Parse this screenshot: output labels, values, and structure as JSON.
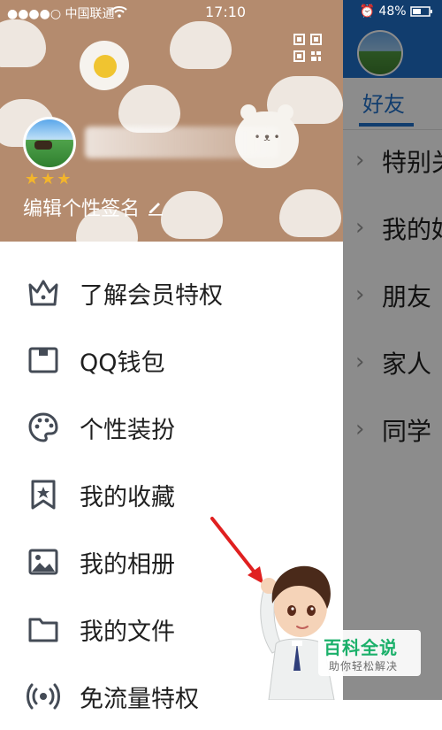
{
  "status_bar": {
    "carrier": "●●●●○ 中国联通",
    "time": "17:10",
    "battery": "48%"
  },
  "header": {
    "stars": "★★★",
    "signature": "编辑个性签名"
  },
  "menu": [
    {
      "label": "了解会员特权",
      "icon": "crown-icon"
    },
    {
      "label": "QQ钱包",
      "icon": "wallet-icon"
    },
    {
      "label": "个性装扮",
      "icon": "palette-icon"
    },
    {
      "label": "我的收藏",
      "icon": "bookmark-star-icon"
    },
    {
      "label": "我的相册",
      "icon": "photo-icon"
    },
    {
      "label": "我的文件",
      "icon": "folder-icon"
    },
    {
      "label": "免流量特权",
      "icon": "signal-icon"
    }
  ],
  "background_screen": {
    "active_tab": "好友",
    "list": [
      {
        "label": "特别关"
      },
      {
        "label": "我的好"
      },
      {
        "label": "朋友"
      },
      {
        "label": "家人"
      },
      {
        "label": "同学"
      }
    ]
  },
  "watermark": {
    "title": "百科全说",
    "subtitle": "助你轻松解决"
  }
}
